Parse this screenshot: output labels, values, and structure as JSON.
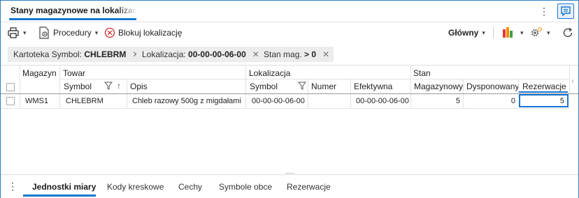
{
  "window": {
    "title": "Stany magazynowe na lokalizacji",
    "menu_icon": "kebab-vertical-icon",
    "chat_icon": "chat-comment-icon"
  },
  "toolbar": {
    "print_icon": "printer-icon",
    "procedures_label": "Procedury",
    "block_label": "Blokuj lokalizację",
    "view_label": "Główny",
    "chart_icon": "bar-chart-icon",
    "settings_icon": "settings-gear-icon",
    "refresh_icon": "refresh-icon"
  },
  "filters": [
    {
      "label": "Kartoteka  Symbol:",
      "value": "CHLEBRM"
    },
    {
      "label": "Lokalizacja:",
      "value": "00-00-00-06-00"
    },
    {
      "label": "Stan mag.",
      "op": ">",
      "value": "0"
    }
  ],
  "grid": {
    "groups": {
      "magazyn": "Magazyn",
      "towar": "Towar",
      "lokalizacja": "Lokalizacja",
      "stan": "Stan"
    },
    "columns": {
      "towar_symbol": "Symbol",
      "opis": "Opis",
      "lok_symbol": "Symbol",
      "numer": "Numer",
      "efektywna": "Efektywna",
      "magazynowy": "Magazynowy",
      "dysponowany": "Dysponowany",
      "rezerwacje": "Rezerwacje"
    },
    "rows": [
      {
        "magazyn": "WMS1",
        "towar_symbol": "CHLEBRM",
        "opis": "Chleb razowy 500g z migdałami",
        "lok_symbol": "00-00-00-06-00",
        "numer": "",
        "efektywna": "00-00-00-06-00",
        "magazynowy": "5",
        "dysponowany": "0",
        "rezerwacje": "5"
      }
    ]
  },
  "bottom_tabs": [
    {
      "label": "Jednostki miary",
      "active": true
    },
    {
      "label": "Kody kreskowe",
      "active": false
    },
    {
      "label": "Cechy",
      "active": false
    },
    {
      "label": "Symbole obce",
      "active": false
    },
    {
      "label": "Rezerwacje",
      "active": false
    }
  ],
  "colors": {
    "accent": "#1976d2",
    "chip_bg": "#ececec",
    "block_icon": "#d32f2f",
    "chart_bars": [
      "#e53935",
      "#fb8c00",
      "#43a047"
    ]
  }
}
